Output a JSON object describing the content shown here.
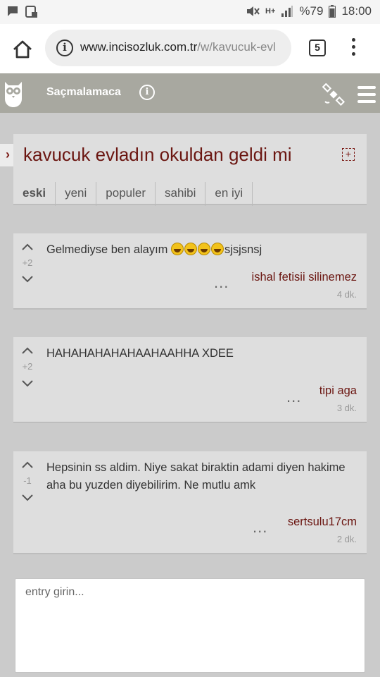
{
  "status_bar": {
    "battery_percent": "%79",
    "time": "18:00",
    "network": "H+",
    "icons": [
      "chat-icon",
      "screenshot-icon",
      "mute-icon",
      "signal-icon",
      "battery-icon"
    ]
  },
  "browser": {
    "url_domain": "www.incisozluk.com.tr",
    "url_path": "/w/kavucuk-evl",
    "tab_count": "5"
  },
  "site": {
    "channel": "Saçmalamaca",
    "colors": {
      "header": "#a8a8a0",
      "accent": "#6b1611"
    }
  },
  "topic": {
    "title": "kavucuk evladın okuldan geldi mi",
    "tabs": [
      {
        "label": "eski",
        "active": true
      },
      {
        "label": "yeni",
        "active": false
      },
      {
        "label": "populer",
        "active": false
      },
      {
        "label": "sahibi",
        "active": false
      },
      {
        "label": "en iyi",
        "active": false
      }
    ]
  },
  "entries": [
    {
      "text": "Gelmediyse ben alayım",
      "emoji_count": 4,
      "text_suffix": "sjsjsnsj",
      "votes": "+2",
      "author": "ishal fetisii silinemez",
      "time": "4 dk."
    },
    {
      "text": "HAHAHAHAHAHAAHAAHHA XDEE",
      "votes": "+2",
      "author": "tipi aga",
      "time": "3 dk."
    },
    {
      "text": "Hepsinin ss aldim. Niye sakat biraktin adami diyen hakime aha bu yuzden diyebilirim. Ne mutlu amk",
      "votes": "-1",
      "author": "sertsulu17cm",
      "time": "2 dk."
    }
  ],
  "composer": {
    "placeholder": "entry girin..."
  }
}
